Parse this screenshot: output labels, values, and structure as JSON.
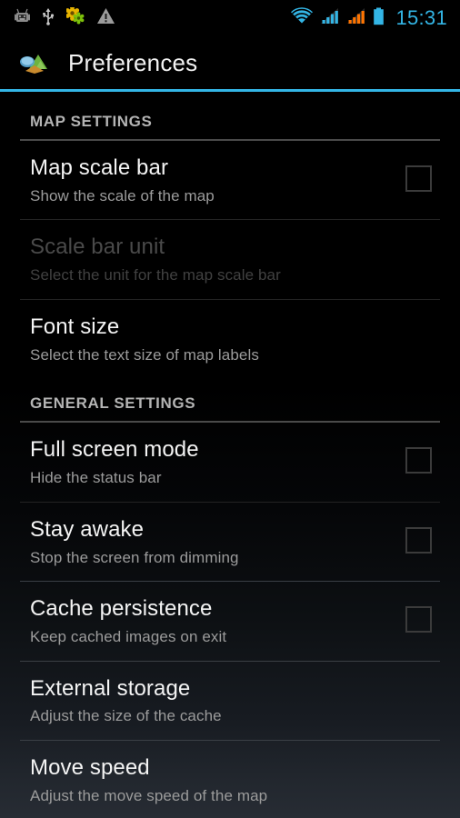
{
  "statusbar": {
    "icons_left": [
      {
        "name": "android-debug-icon",
        "label": "Android debug"
      },
      {
        "name": "usb-icon",
        "label": "USB connected"
      },
      {
        "name": "developer-settings-icon",
        "label": "Developer settings"
      },
      {
        "name": "warning-icon",
        "label": "Warning"
      }
    ],
    "icons_right": [
      {
        "name": "wifi-icon",
        "label": "Wi-Fi"
      },
      {
        "name": "signal-sim1-icon",
        "label": "Signal SIM 1"
      },
      {
        "name": "signal-sim2-icon",
        "label": "Signal SIM 2"
      },
      {
        "name": "battery-icon",
        "label": "Battery"
      }
    ],
    "clock": "15:31"
  },
  "actionbar": {
    "icon": "map-app-icon",
    "title": "Preferences"
  },
  "colors": {
    "accent": "#33b5e5",
    "title_text": "#f4f4f4",
    "summary_text": "#9b9b9b",
    "section_text": "#b4b4b4",
    "disabled_text": "#4a4a4a",
    "background": "#000000",
    "background_bottom": "#272c34",
    "checkbox_border": "#3b3b3b"
  },
  "sections": [
    {
      "header": "MAP SETTINGS",
      "items": [
        {
          "title": "Map scale bar",
          "summary": "Show the scale of the map",
          "widget": "checkbox",
          "checked": false,
          "enabled": true
        },
        {
          "title": "Scale bar unit",
          "summary": "Select the unit for the map scale bar",
          "widget": "none",
          "checked": false,
          "enabled": false
        },
        {
          "title": "Font size",
          "summary": "Select the text size of map labels",
          "widget": "none",
          "checked": false,
          "enabled": true
        }
      ]
    },
    {
      "header": "GENERAL SETTINGS",
      "items": [
        {
          "title": "Full screen mode",
          "summary": "Hide the status bar",
          "widget": "checkbox",
          "checked": false,
          "enabled": true
        },
        {
          "title": "Stay awake",
          "summary": "Stop the screen from dimming",
          "widget": "checkbox",
          "checked": false,
          "enabled": true
        },
        {
          "title": "Cache persistence",
          "summary": "Keep cached images on exit",
          "widget": "checkbox",
          "checked": false,
          "enabled": true
        },
        {
          "title": "External storage",
          "summary": "Adjust the size of the cache",
          "widget": "none",
          "checked": false,
          "enabled": true
        },
        {
          "title": "Move speed",
          "summary": "Adjust the move speed of the map",
          "widget": "none",
          "checked": false,
          "enabled": true
        }
      ]
    }
  ]
}
